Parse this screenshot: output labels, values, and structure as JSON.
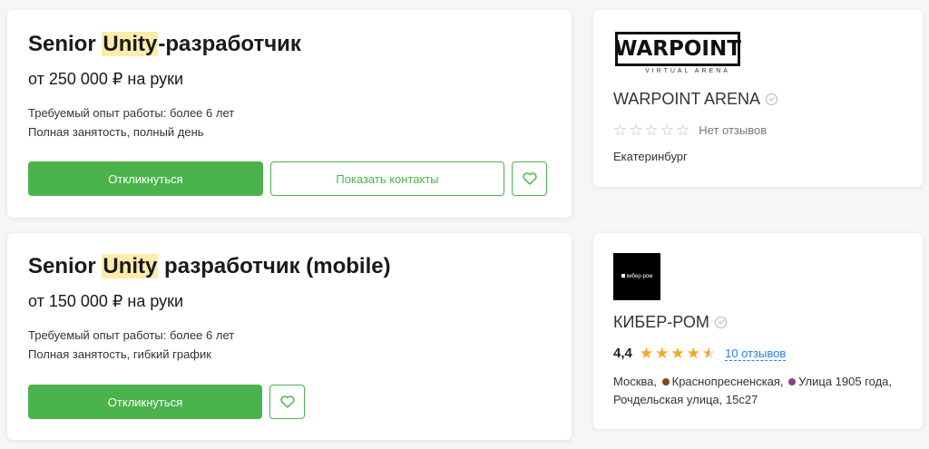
{
  "vacancies": [
    {
      "title_before": "Senior ",
      "title_highlight": "Unity",
      "title_after": "-разработчик",
      "salary": "от 250 000 ₽ на руки",
      "experience": "Требуемый опыт работы: более 6 лет",
      "schedule": "Полная занятость, полный день",
      "respond_label": "Откликнуться",
      "contacts_label": "Показать контакты"
    },
    {
      "title_before": "Senior ",
      "title_highlight": "Unity",
      "title_after": " разработчик (mobile)",
      "salary": "от 150 000 ₽ на руки",
      "experience": "Требуемый опыт работы: более 6 лет",
      "schedule": "Полная занятость, гибкий график",
      "respond_label": "Откликнуться"
    }
  ],
  "employers": [
    {
      "logo_text": "WARPOINT",
      "logo_subtext": "VIRTUAL ARENA",
      "name": "WARPOINT ARENA",
      "no_reviews": "Нет отзывов",
      "city": "Екатеринбург"
    },
    {
      "logo_text": "кибер-ром",
      "name": "КИБЕР-РОМ",
      "rating": "4,4",
      "rating_value": 4.4,
      "reviews": "10 отзывов",
      "city": "Москва,",
      "metro1": "Краснопресненская,",
      "metro1_color": "#8b4513",
      "metro2": "Улица 1905 года,",
      "metro2_color": "#8e3a8e",
      "address": "Рочдельская улица, 15с27"
    }
  ],
  "colors": {
    "accent": "#4bb34b",
    "highlight": "#ffecad",
    "star": "#f5a623",
    "link": "#2b7de9"
  }
}
